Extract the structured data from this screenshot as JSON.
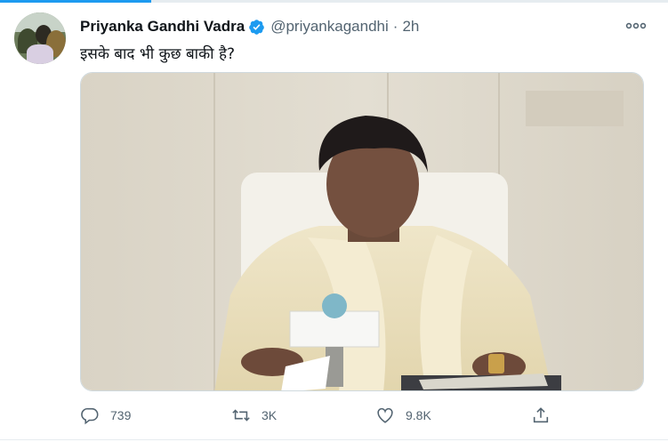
{
  "tweet": {
    "author_name": "Priyanka Gandhi Vadra",
    "handle": "@priyankagandhi",
    "separator": "·",
    "time": "2h",
    "text": "इसके बाद भी कुछ बाकी है?"
  },
  "actions": {
    "replies": "739",
    "retweets": "3K",
    "likes": "9.8K"
  },
  "colors": {
    "accent": "#1d9bf0",
    "secondary_text": "#536471",
    "primary_text": "#0f1419"
  },
  "icons": [
    "verified-badge-icon",
    "more-icon",
    "reply-icon",
    "retweet-icon",
    "like-icon",
    "share-icon"
  ]
}
